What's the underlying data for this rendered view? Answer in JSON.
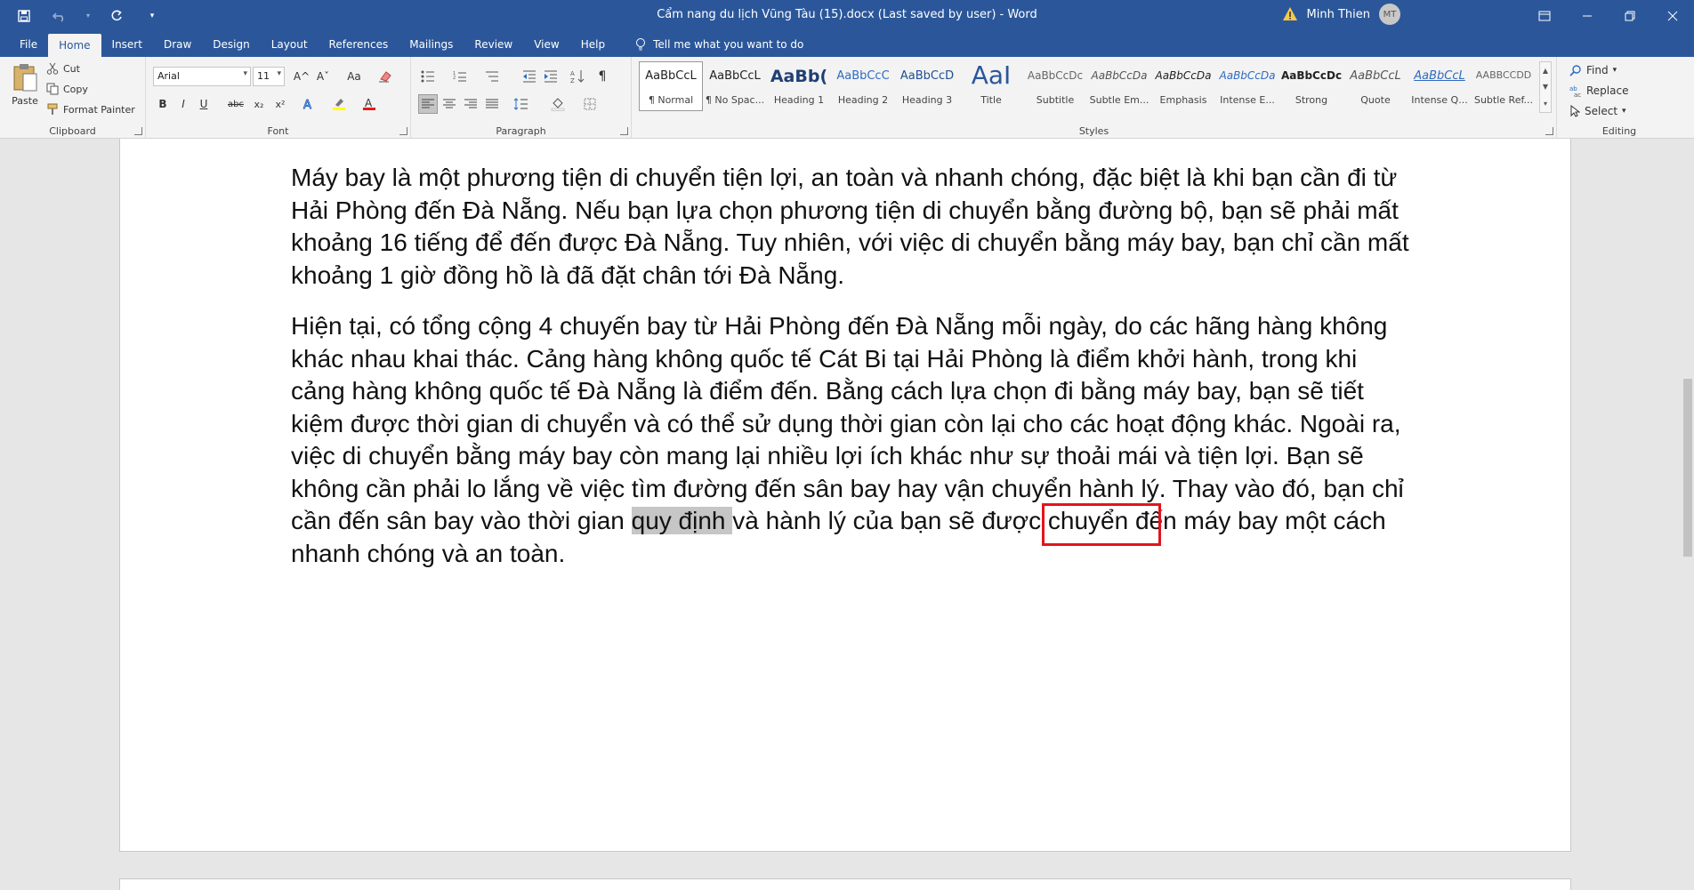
{
  "window": {
    "title": "Cẩm nang du lịch Vũng Tàu (15).docx (Last saved by user)  -  Word",
    "user_name": "Minh Thien",
    "user_initials": "MT"
  },
  "tabs": [
    "File",
    "Home",
    "Insert",
    "Draw",
    "Design",
    "Layout",
    "References",
    "Mailings",
    "Review",
    "View",
    "Help"
  ],
  "active_tab": "Home",
  "tell_me": "Tell me what you want to do",
  "clipboard": {
    "paste": "Paste",
    "cut": "Cut",
    "copy": "Copy",
    "format_painter": "Format Painter",
    "label": "Clipboard"
  },
  "font": {
    "name": "Arial",
    "size": "11",
    "label": "Font",
    "bold": "B",
    "italic": "I",
    "underline": "U",
    "strike": "abc",
    "subscript": "x₂",
    "superscript": "x²",
    "grow": "A^",
    "shrink": "Aˇ",
    "case": "Aa"
  },
  "paragraph": {
    "label": "Paragraph"
  },
  "styles": {
    "label": "Styles",
    "items": [
      {
        "sample": "AaBbCcL",
        "name": "¶ Normal"
      },
      {
        "sample": "AaBbCcL",
        "name": "¶ No Spac..."
      },
      {
        "sample": "AaBb(",
        "name": "Heading 1"
      },
      {
        "sample": "AaBbCcC",
        "name": "Heading 2"
      },
      {
        "sample": "AaBbCcD",
        "name": "Heading 3"
      },
      {
        "sample": "AaI",
        "name": "Title"
      },
      {
        "sample": "AaBbCcDc",
        "name": "Subtitle"
      },
      {
        "sample": "AaBbCcDa",
        "name": "Subtle Em..."
      },
      {
        "sample": "AaBbCcDa",
        "name": "Emphasis"
      },
      {
        "sample": "AaBbCcDa",
        "name": "Intense E..."
      },
      {
        "sample": "AaBbCcDc",
        "name": "Strong"
      },
      {
        "sample": "AaBbCcL",
        "name": "Quote"
      },
      {
        "sample": "AaBbCcL",
        "name": "Intense Q..."
      },
      {
        "sample": "AABBCCDD",
        "name": "Subtle Ref..."
      }
    ]
  },
  "editing": {
    "label": "Editing",
    "find": "Find",
    "replace": "Replace",
    "select": "Select"
  },
  "document": {
    "paragraph1": "Máy bay là một phương tiện di chuyển tiện lợi, an toàn và nhanh chóng, đặc biệt là khi bạn cần đi từ Hải Phòng đến Đà Nẵng. Nếu bạn lựa chọn phương tiện di chuyển bằng đường bộ, bạn sẽ phải mất khoảng 16 tiếng để đến được Đà Nẵng. Tuy nhiên, với việc di chuyển bằng máy bay, bạn chỉ cần mất khoảng 1 giờ đồng hồ là đã đặt chân tới Đà Nẵng.",
    "paragraph2_before": "Hiện tại, có tổng cộng 4 chuyến bay từ Hải Phòng đến Đà Nẵng mỗi ngày, do các hãng hàng không khác nhau khai thác. Cảng hàng không quốc tế Cát Bi tại Hải Phòng là điểm khởi hành, trong khi cảng hàng không quốc tế Đà Nẵng là điểm đến. Bằng cách lựa chọn đi bằng máy bay, bạn sẽ tiết kiệm được thời gian di chuyển và có thể sử dụng thời gian còn lại cho các hoạt động khác. Ngoài ra, việc di chuyển bằng máy bay còn mang lại nhiều lợi ích khác như sự thoải mái và tiện lợi. Bạn sẽ không cần phải lo lắng về việc tìm đường đến sân bay hay vận chuyển hành lý. Thay vào đó, bạn chỉ cần đến sân bay vào thời gian ",
    "paragraph2_selected": "quy định ",
    "paragraph2_after": "và hành lý của bạn sẽ được chuyển đến máy bay một cách nhanh chóng và an toàn."
  }
}
